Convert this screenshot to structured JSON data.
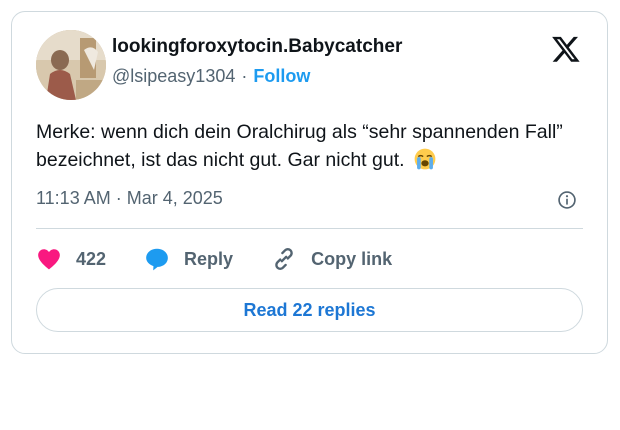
{
  "post": {
    "display_name": "lookingforoxytocin.Babycatcher",
    "handle": "@lsipeasy1304",
    "separator": "·",
    "follow_label": "Follow",
    "text": "Merke: wenn dich dein Oralchirug als “sehr spannenden Fall” bezeichnet, ist das nicht gut. Gar nicht gut.",
    "emoji": "loudly-crying-face",
    "time": "11:13 AM",
    "date": "Mar 4, 2025"
  },
  "actions": {
    "like_count": "422",
    "reply_label": "Reply",
    "copy_label": "Copy link"
  },
  "footer": {
    "read_replies_label": "Read 22 replies"
  },
  "icons": [
    "x-logo-icon",
    "info-icon",
    "heart-icon",
    "reply-bubble-icon",
    "link-icon"
  ],
  "colors": {
    "accent": "#1d9bf0",
    "like": "#f91880",
    "reply": "#1d9bf0",
    "secondary_text": "#536471",
    "border": "#cfd9de"
  }
}
